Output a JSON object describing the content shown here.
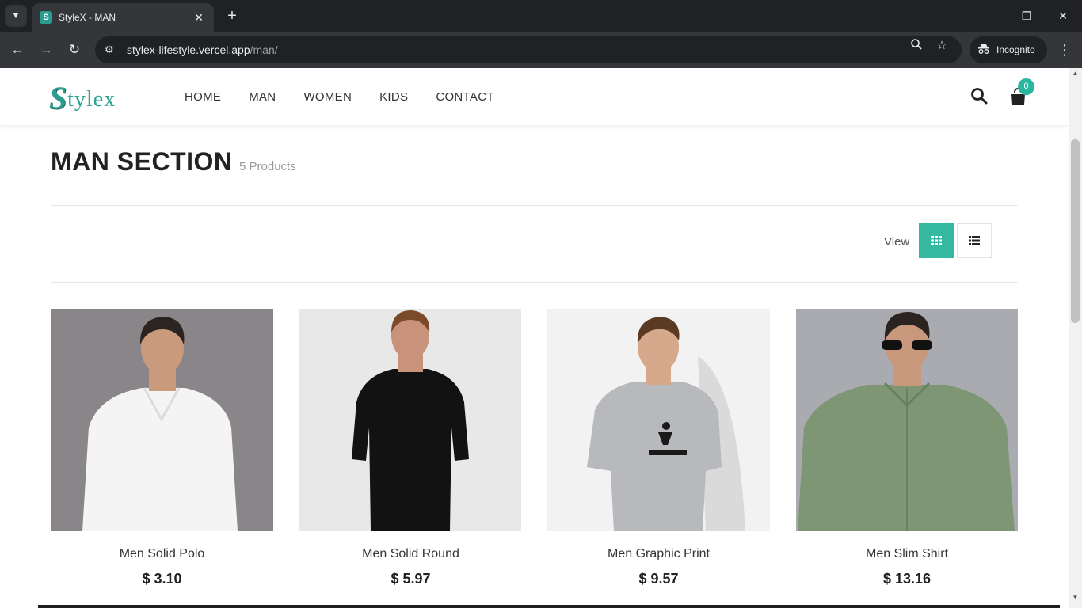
{
  "browser": {
    "tab_title": "StyleX - MAN",
    "tab_favicon_letter": "S",
    "url_host": "stylex-lifestyle.vercel.app",
    "url_path": "/man/",
    "incognito_label": "Incognito"
  },
  "header": {
    "logo_initial": "S",
    "logo_rest": "tylex",
    "nav": [
      "HOME",
      "MAN",
      "WOMEN",
      "KIDS",
      "CONTACT"
    ],
    "cart_count": "0"
  },
  "section": {
    "title": "MAN SECTION",
    "count": "5 Products",
    "view_label": "View"
  },
  "products": [
    {
      "name": "Men Solid Polo",
      "price": "$ 3.10",
      "bg": "#8a8589",
      "shirt": "#f4f4f4"
    },
    {
      "name": "Men Solid Round",
      "price": "$ 5.97",
      "bg": "#e8e8e8",
      "shirt": "#121212"
    },
    {
      "name": "Men Graphic Print",
      "price": "$ 9.57",
      "bg": "#f2f2f2",
      "shirt": "#b8b9bc"
    },
    {
      "name": "Men Slim Shirt",
      "price": "$ 13.16",
      "bg": "#a9abb0",
      "shirt": "#7e9674"
    }
  ],
  "colors": {
    "accent": "#35b8a0",
    "logo": "#2a9d8f"
  }
}
